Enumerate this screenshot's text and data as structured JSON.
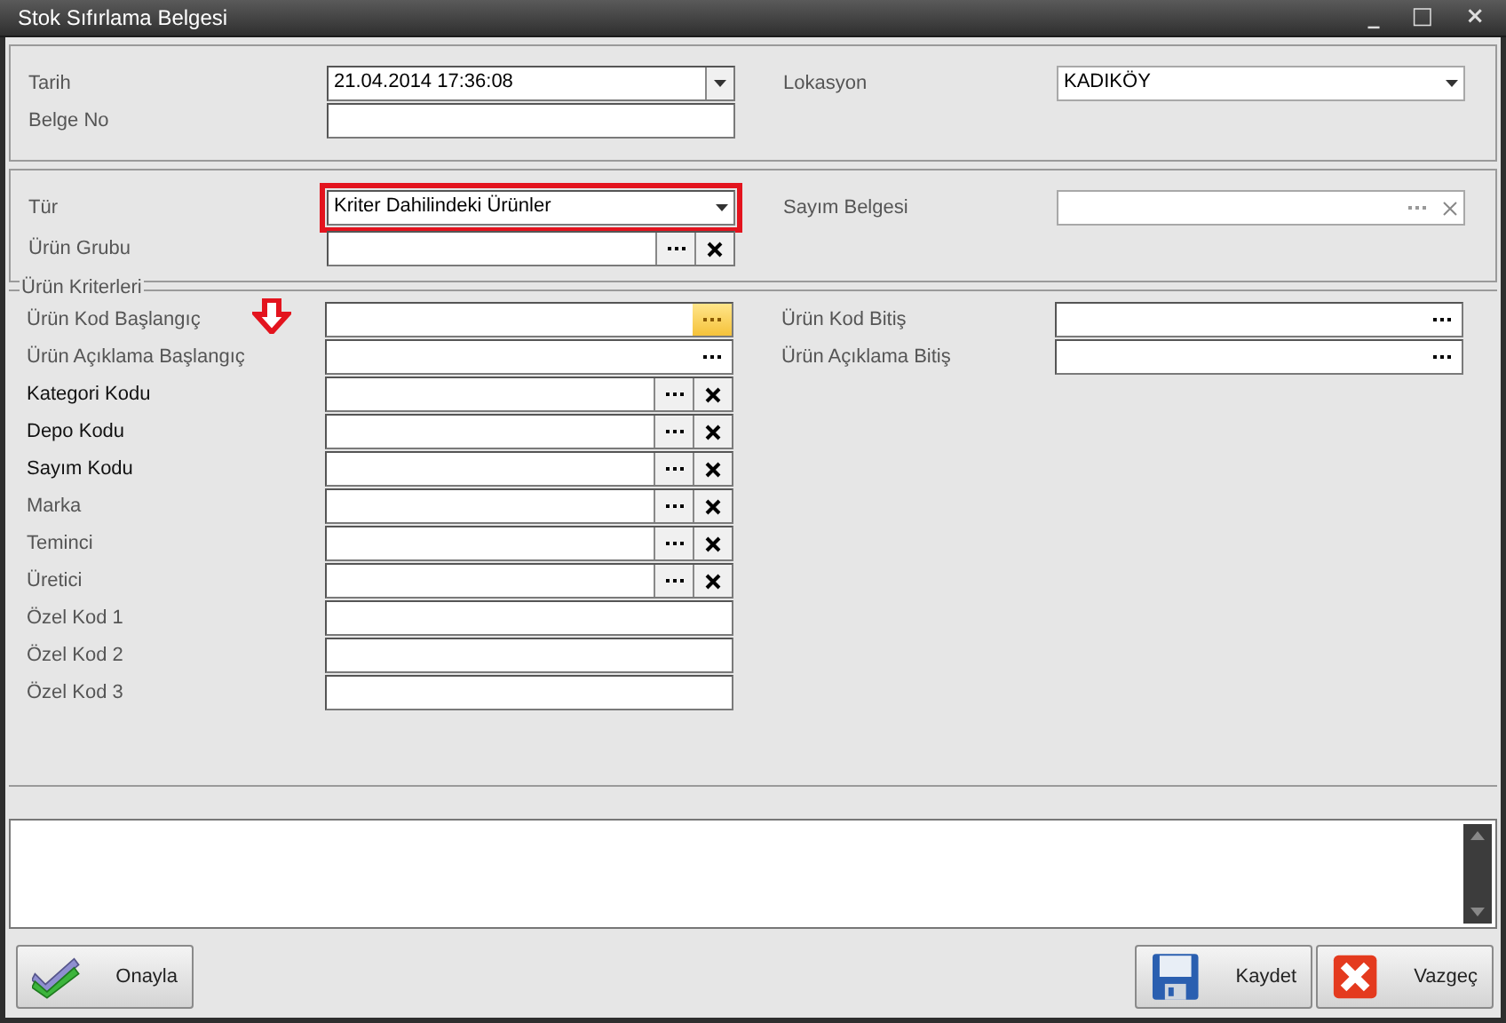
{
  "window": {
    "title": "Stok Sıfırlama Belgesi",
    "controls": [
      "_",
      "□",
      "×"
    ]
  },
  "header": {
    "left": [
      {
        "label": "Tarih",
        "kind": "date",
        "value": "21.04.2014 17:36:08"
      },
      {
        "label": "Belge No",
        "kind": "text"
      }
    ],
    "right": [
      {
        "label": "Lokasyon",
        "kind": "combo",
        "value": "KADIKÖY"
      }
    ]
  },
  "selection": {
    "left": [
      {
        "label": "Tür",
        "kind": "combo_box",
        "value": "Kriter Dahilindeki Ürünler",
        "highlighted": true
      },
      {
        "label": "Ürün Grubu",
        "kind": "lookup",
        "highlighted": false
      }
    ],
    "right": [
      {
        "label": "Sayım Belgesi",
        "kind": "lookup_flat"
      }
    ]
  },
  "criteria": {
    "title": "Ürün Kriterleri",
    "left": [
      {
        "label": "Ürün Kod Başlangıç",
        "kind": "browse",
        "focused": true,
        "strong": false
      },
      {
        "label": "Ürün Açıklama Başlangıç",
        "kind": "browse",
        "focused": false,
        "strong": false
      },
      {
        "label": "Kategori Kodu",
        "kind": "lookup",
        "strong": true
      },
      {
        "label": "Depo Kodu",
        "kind": "lookup",
        "strong": true
      },
      {
        "label": "Sayım Kodu",
        "kind": "lookup",
        "strong": true
      },
      {
        "label": "Marka",
        "kind": "lookup",
        "strong": false
      },
      {
        "label": "Teminci",
        "kind": "lookup",
        "strong": false
      },
      {
        "label": "Üretici",
        "kind": "lookup",
        "strong": false
      },
      {
        "label": "Özel Kod 1",
        "kind": "text",
        "strong": false
      },
      {
        "label": "Özel Kod 2",
        "kind": "text",
        "strong": false
      },
      {
        "label": "Özel Kod 3",
        "kind": "text",
        "strong": false
      }
    ],
    "right": [
      {
        "label": "Ürün Kod Bitiş",
        "kind": "browse",
        "focused": false
      },
      {
        "label": "Ürün Açıklama Bitiş",
        "kind": "browse",
        "focused": false
      }
    ]
  },
  "buttons": [
    {
      "label": "Onayla",
      "kind": "approve"
    },
    {
      "label": "Kaydet",
      "kind": "save"
    },
    {
      "label": "Vazgeç",
      "kind": "cancel"
    }
  ]
}
